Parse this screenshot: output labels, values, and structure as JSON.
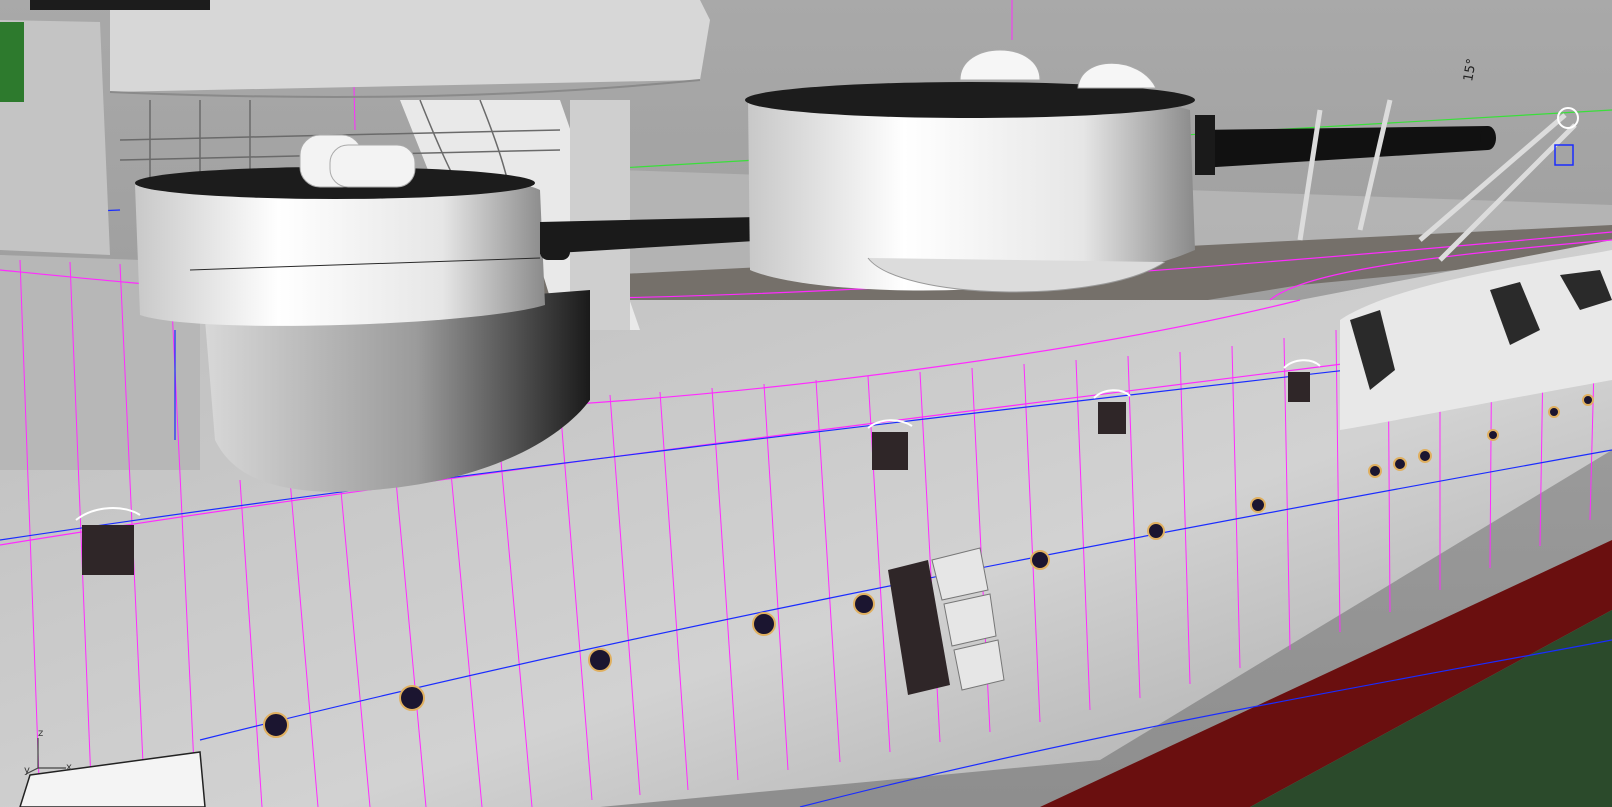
{
  "viewport": {
    "angle_annotation": "15°",
    "axes": {
      "z": "z",
      "y": "y",
      "x": "x"
    }
  },
  "colors": {
    "hull_grey": "#c9c9c9",
    "deck_brown": "#75706a",
    "isocurve_magenta": "#ff2bff",
    "edge_blue": "#1a2cff",
    "selection_green": "#3adf3a",
    "boot_topping_red": "#6a0f0f",
    "hull_below_green": "#2b4a2b",
    "turret_white": "#f2f2f2",
    "gun_black": "#111111"
  },
  "icons": [
    "camera-target-icon",
    "world-axes-icon"
  ]
}
